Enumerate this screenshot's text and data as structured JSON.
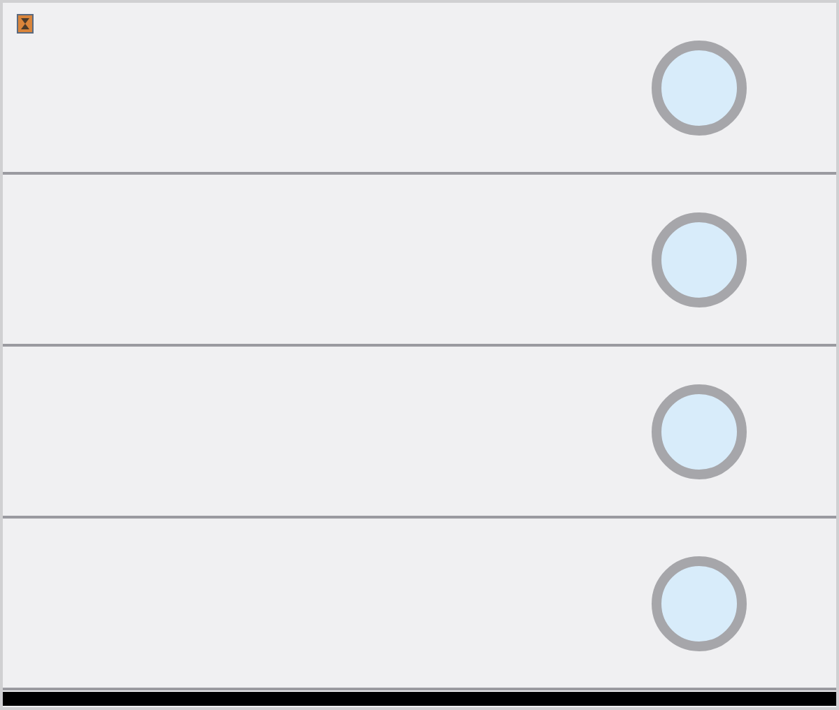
{
  "rows": [
    {
      "kind": "radio",
      "selected": false
    },
    {
      "kind": "radio",
      "selected": false
    },
    {
      "kind": "radio",
      "selected": false
    },
    {
      "kind": "radio",
      "selected": false
    }
  ]
}
